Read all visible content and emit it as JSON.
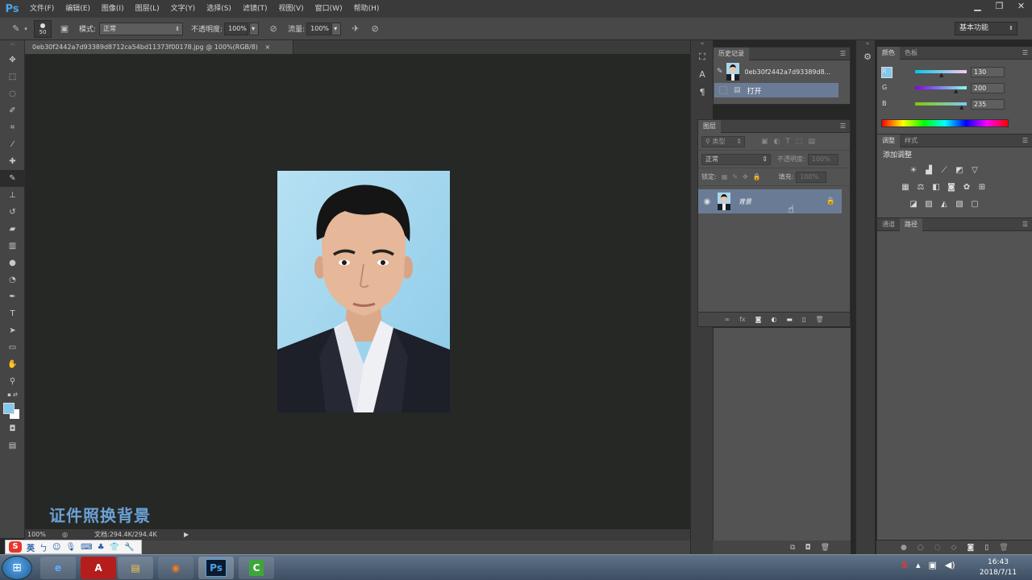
{
  "app": {
    "logo": "Ps"
  },
  "menu": [
    "文件(F)",
    "编辑(E)",
    "图像(I)",
    "图层(L)",
    "文字(Y)",
    "选择(S)",
    "滤镜(T)",
    "视图(V)",
    "窗口(W)",
    "帮助(H)"
  ],
  "window_controls": {
    "minimize": "▁",
    "restore": "❐",
    "close": "✕"
  },
  "options": {
    "brush_size": "50",
    "mode_label": "模式:",
    "mode_value": "正常",
    "opacity_label": "不透明度:",
    "opacity_value": "100%",
    "flow_label": "流量:",
    "flow_value": "100%",
    "workspace": "基本功能"
  },
  "document": {
    "tab_title": "0eb30f2442a7d93389d8712ca54bd11373f00178.jpg @ 100%(RGB/8)",
    "tab_close": "×",
    "zoom": "100%",
    "doc_size": "文档:294.4K/294.4K"
  },
  "watermark": "证件照换背景",
  "history": {
    "tab": "历史记录",
    "snapshot_name": "0eb30f2442a7d93389d8...",
    "step": "打开"
  },
  "layers": {
    "tab": "图层",
    "filter_kind": "类型",
    "blend_mode": "正常",
    "opacity_label": "不透明度:",
    "opacity_value": "100%",
    "lock_label": "锁定:",
    "fill_label": "填充:",
    "fill_value": "100%",
    "layer_name": "背景"
  },
  "color_panel": {
    "tab_active": "颜色",
    "tab_other": "色板",
    "r_label": "R",
    "r_value": "130",
    "g_label": "G",
    "g_value": "200",
    "b_label": "B",
    "b_value": "235",
    "foreground_color": "#82c8eb"
  },
  "adjust_panel": {
    "tab_active": "调整",
    "tab_other": "样式",
    "title": "添加调整"
  },
  "paths_panel": {
    "tab_other": "通道",
    "tab_active": "路径"
  },
  "ime": {
    "logo": "S",
    "lang": "英"
  },
  "taskbar": {
    "apps": [
      {
        "name": "ie",
        "glyph": "e"
      },
      {
        "name": "acrobat",
        "glyph": "A"
      },
      {
        "name": "explorer",
        "glyph": "▤"
      },
      {
        "name": "firefox",
        "glyph": "◉"
      },
      {
        "name": "photoshop",
        "glyph": "Ps"
      },
      {
        "name": "camtasia",
        "glyph": "C"
      }
    ],
    "time": "16:43",
    "date": "2018/7/11"
  }
}
